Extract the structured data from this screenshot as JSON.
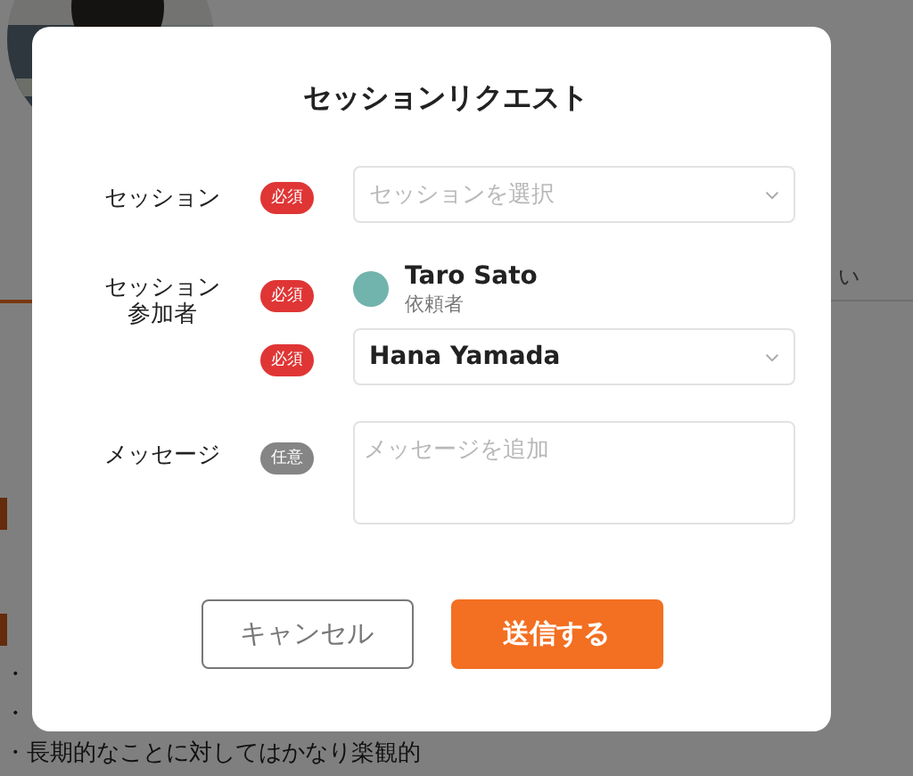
{
  "page": {
    "lines": [
      {
        "kind": "tab",
        "text": "い"
      },
      {
        "kind": "section"
      },
      {
        "kind": "section"
      },
      {
        "kind": "bullet",
        "text": "・"
      },
      {
        "kind": "bullet",
        "text": "・"
      },
      {
        "kind": "bullet",
        "text": "・長期的なことに対してはかなり楽観的"
      }
    ]
  },
  "modal": {
    "title": "セッションリクエスト",
    "fields": [
      {
        "kind": "select",
        "label": "セッション",
        "badge": "必須",
        "required": true,
        "placeholder": "セッションを選択"
      },
      {
        "kind": "person",
        "label": "セッション参加者",
        "badge": "必須",
        "required": true,
        "name": "Taro Sato",
        "role": "依頼者"
      },
      {
        "kind": "select",
        "badge": "必須",
        "required": true,
        "value": "Hana Yamada"
      },
      {
        "kind": "textarea",
        "label": "メッセージ",
        "badge": "任意",
        "required": false,
        "placeholder": "メッセージを追加"
      }
    ],
    "buttons": [
      {
        "kind": "secondary",
        "label": "キャンセル"
      },
      {
        "kind": "primary",
        "label": "送信する"
      }
    ]
  }
}
